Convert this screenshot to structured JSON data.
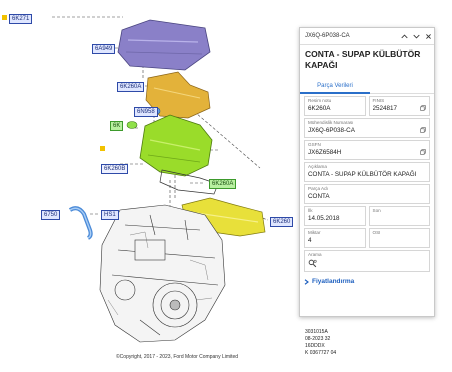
{
  "callouts": {
    "c6k271": "6K271",
    "c6a949": "6A949",
    "c6k260a": "6K260A",
    "c6n958": "6N958",
    "c6k": "6K",
    "c6k260b": "6K260B",
    "c6k260a2": "6K260A",
    "c6k260": "6K260",
    "c6750": "6750",
    "chs1": "HS1"
  },
  "diagram": {
    "copyright": "©Copyright, 2017 - 2023, Ford Motor Company Limited",
    "ref_block": "3031015A\n08-2023 32\n16DDDX\nK 0367727 04"
  },
  "panel": {
    "part_number": "JX6Q-6P038-CA",
    "title": "CONTA - SUPAP KÜLBÜTÖR KAPAĞI",
    "tab_label": "Parça Verileri",
    "fields": {
      "resim_notu_label": "Resim notu",
      "resim_notu_value": "6K260A",
      "finis_label": "FINIS",
      "finis_value": "2524817",
      "muhendislik_label": "Mühendislik Numarası",
      "muhendislik_value": "JX6Q-6P038-CA",
      "gsfn_label": "GSFN",
      "gsfn_value": "JX6Z6584H",
      "aciklama_label": "Açıklama",
      "aciklama_value": "CONTA - SUPAP KÜLBÜTÖR KAPAĞI",
      "parca_adi_label": "Parça Adı",
      "parca_adi_value": "CONTA",
      "ilk_label": "İlk",
      "ilk_value": "14.05.2018",
      "son_label": "Son",
      "son_value": "",
      "miktar_label": "Miktar",
      "miktar_value": "4",
      "osi_label": "OSI",
      "osi_value": "",
      "arama_label": "Arama"
    },
    "pricing_label": "Fiyatlandırma",
    "icons": [
      "chevron-up-icon",
      "chevron-down-icon",
      "close-icon",
      "copy-icon",
      "search-icon",
      "chevron-right-icon"
    ]
  },
  "colors": {
    "accent": "#2a6fc9",
    "callout_fill": "#dfe6ff",
    "callout_highlight": "#b8f0a0",
    "part_yellow": "#e8e03a",
    "part_orange": "#e0b030",
    "part_purple": "#8a80c8",
    "part_green": "#9adc2a"
  }
}
